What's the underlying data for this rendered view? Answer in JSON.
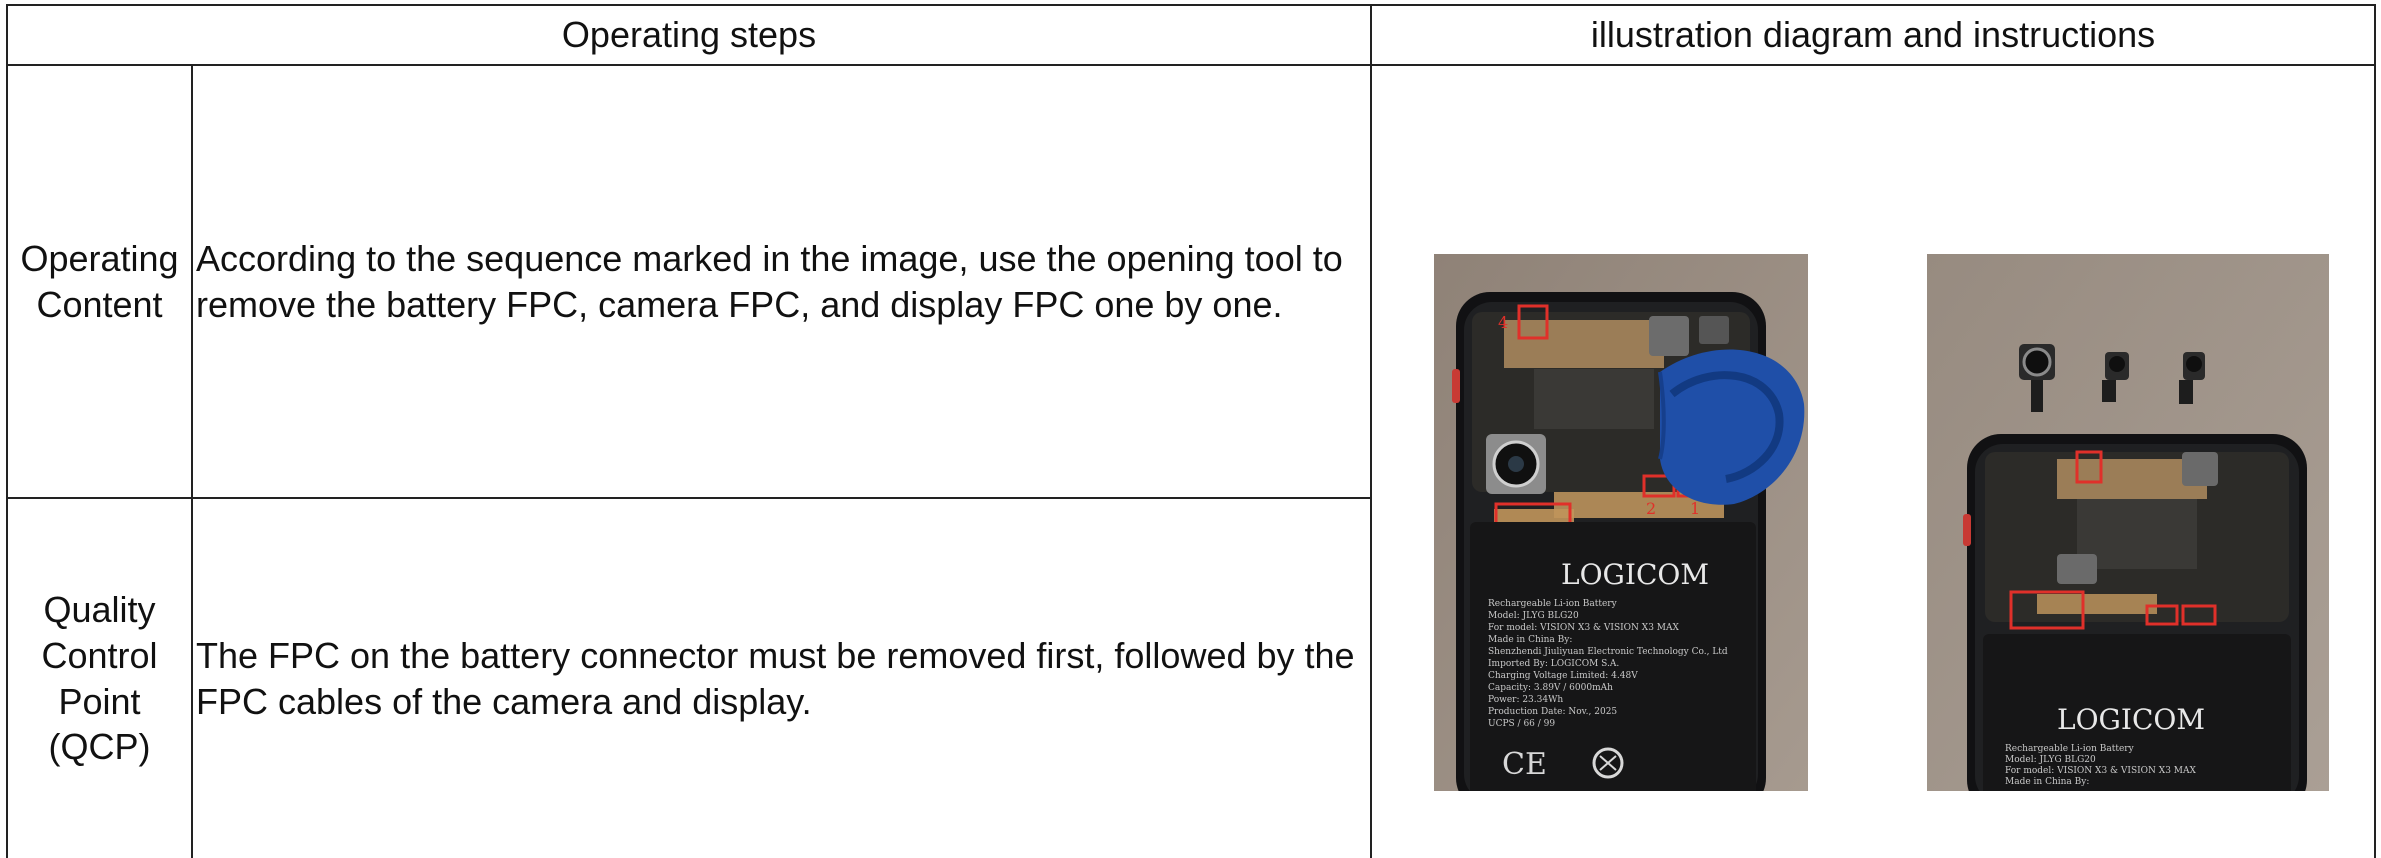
{
  "table": {
    "header_steps": "Operating steps",
    "header_illustration": "illustration diagram and instructions",
    "rows": [
      {
        "label": "Operating Content",
        "content": "According to the sequence marked in the image, use the opening tool to remove the battery FPC, camera FPC, and display FPC one by one."
      },
      {
        "label": "Quality Control Point (QCP)",
        "content": "The FPC on the battery connector must be removed first, followed by the FPC cables of the camera and display."
      }
    ]
  },
  "photos": {
    "left": {
      "brand": "LOGICOM",
      "markers": [
        "4",
        "3",
        "2",
        "1"
      ],
      "label_lines": [
        "Rechargeable Li-ion Battery",
        "Model: JLYG BLG20",
        "For model: VISION X3 & VISION X3 MAX",
        "Made in China By:",
        "Shenzhendi Jiuliyuan Electronic Technology Co., Ltd",
        "Imported By: LOGICOM S.A.",
        "Charging Voltage Limited: 4.48V",
        "Capacity: 3.89V / 6000mAh",
        "Power: 23.34Wh",
        "Production Date: Nov., 2025",
        "UCPS / 66 / 99"
      ],
      "cert_marks": "CE"
    },
    "right": {
      "brand": "LOGICOM",
      "label_lines": [
        "Rechargeable Li-ion Battery",
        "Model: JLYG BLG20",
        "For model: VISION X3 & VISION X3 MAX",
        "Made in China By:"
      ]
    }
  },
  "colors": {
    "border": "#222222",
    "marker_red": "#e0302a",
    "tool_blue": "#1f4fa8"
  }
}
